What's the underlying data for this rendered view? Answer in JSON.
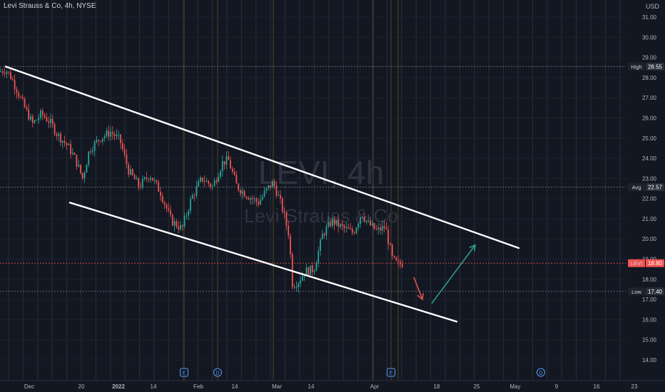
{
  "header": {
    "symbol_title": "Levi Strauss & Co, 4h, NYSE",
    "currency": "USD"
  },
  "watermark": {
    "line1": "LEVI, 4h",
    "line2": "Levi Strauss & Co"
  },
  "colors": {
    "background": "#131722",
    "up": "#26a69a",
    "down": "#ef5350",
    "trendline": "#ffffff",
    "arrow_down": "#e0524f",
    "arrow_up": "#2a9d8f",
    "grid_vertical": "#2a2e39",
    "grid_vertical_gold": "#6b5a2a"
  },
  "chart_data": {
    "type": "candlestick",
    "title": "Levi Strauss & Co, 4h, NYSE",
    "ylabel": "USD",
    "ylim": [
      13.5,
      31.5
    ],
    "y_ticks": [
      "31.00",
      "30.00",
      "29.00",
      "28.00",
      "27.00",
      "26.00",
      "25.00",
      "24.00",
      "23.00",
      "22.00",
      "21.00",
      "20.00",
      "19.00",
      "18.00",
      "17.00",
      "16.00",
      "15.00",
      "14.00"
    ],
    "x_ticks": [
      "Dec",
      "20",
      "2022",
      "14",
      "Feb",
      "14",
      "Mar",
      "14",
      "Apr",
      "18",
      "25",
      "May",
      "9",
      "16",
      "23"
    ],
    "markers": [
      {
        "label": "High",
        "value": 28.55,
        "value_text": "28.55"
      },
      {
        "label": "Avg",
        "value": 22.57,
        "value_text": "22.57"
      },
      {
        "label": "LEVI",
        "value": 18.8,
        "value_text": "18.80"
      },
      {
        "label": "Low",
        "value": 17.4,
        "value_text": "17.40"
      }
    ],
    "events": [
      "E",
      "D",
      "E",
      "D"
    ],
    "price_path": [
      [
        0,
        28.3
      ],
      [
        8,
        28.4
      ],
      [
        16,
        28.0
      ],
      [
        26,
        27.2
      ],
      [
        36,
        26.4
      ],
      [
        46,
        25.7
      ],
      [
        58,
        26.2
      ],
      [
        70,
        25.8
      ],
      [
        80,
        25.2
      ],
      [
        95,
        24.6
      ],
      [
        105,
        24.0
      ],
      [
        116,
        23.0
      ],
      [
        125,
        24.4
      ],
      [
        140,
        25.0
      ],
      [
        155,
        25.3
      ],
      [
        168,
        24.9
      ],
      [
        180,
        23.4
      ],
      [
        195,
        22.6
      ],
      [
        210,
        23.2
      ],
      [
        225,
        22.3
      ],
      [
        240,
        20.9
      ],
      [
        255,
        20.5
      ],
      [
        268,
        22.0
      ],
      [
        283,
        23.0
      ],
      [
        298,
        22.6
      ],
      [
        312,
        23.8
      ],
      [
        320,
        23.9
      ],
      [
        332,
        22.6
      ],
      [
        345,
        22.2
      ],
      [
        362,
        21.8
      ],
      [
        375,
        22.5
      ],
      [
        383,
        22.8
      ],
      [
        395,
        21.6
      ],
      [
        405,
        20.2
      ],
      [
        410,
        17.7
      ],
      [
        418,
        17.9
      ],
      [
        428,
        18.4
      ],
      [
        440,
        18.5
      ],
      [
        452,
        20.2
      ],
      [
        465,
        20.9
      ],
      [
        478,
        20.6
      ],
      [
        495,
        20.3
      ],
      [
        507,
        21.3
      ],
      [
        515,
        20.8
      ],
      [
        528,
        20.4
      ],
      [
        540,
        20.6
      ],
      [
        550,
        19.0
      ],
      [
        558,
        18.7
      ],
      [
        564,
        18.8
      ]
    ],
    "channel": [
      {
        "name": "",
        "x1": "late Nov",
        "y1": 28.55,
        "x2": "early May",
        "y2": 19.55
      },
      {
        "name": "",
        "x1": "mid Dec",
        "y1": 21.8,
        "x2": "mid May",
        "y2": 15.9
      }
    ],
    "projection_arrows": [
      {
        "direction": "down",
        "from": 18.1,
        "to": 17.0
      },
      {
        "direction": "up",
        "from": 16.8,
        "to": 19.7
      }
    ]
  }
}
